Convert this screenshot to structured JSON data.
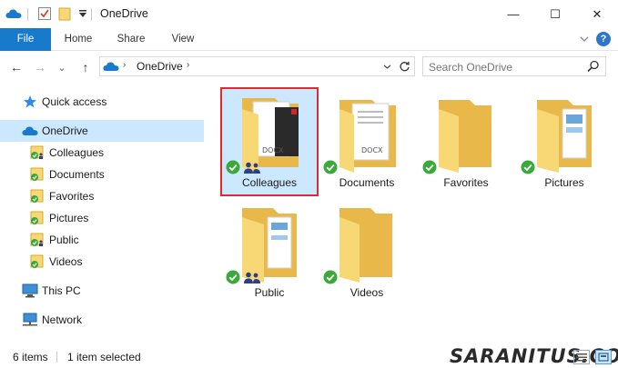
{
  "window": {
    "title": "OneDrive",
    "minimize_glyph": "—",
    "maximize_glyph": "☐",
    "close_glyph": "✕"
  },
  "ribbon": {
    "tabs": [
      {
        "label": "File"
      },
      {
        "label": "Home"
      },
      {
        "label": "Share"
      },
      {
        "label": "View"
      }
    ],
    "help_glyph": "?"
  },
  "navigation": {
    "back_glyph": "←",
    "forward_glyph": "→",
    "recent_glyph": "⌄",
    "up_glyph": "↑",
    "breadcrumb": "OneDrive",
    "search_placeholder": "Search OneDrive"
  },
  "sidebar": {
    "items": [
      {
        "label": "Quick access",
        "icon": "star-icon"
      },
      {
        "label": "OneDrive",
        "icon": "onedrive-cloud-icon"
      },
      {
        "label": "Colleagues",
        "icon": "folder-synced-icon"
      },
      {
        "label": "Documents",
        "icon": "folder-synced-icon"
      },
      {
        "label": "Favorites",
        "icon": "folder-synced-icon"
      },
      {
        "label": "Pictures",
        "icon": "folder-synced-icon"
      },
      {
        "label": "Public",
        "icon": "folder-synced-icon"
      },
      {
        "label": "Videos",
        "icon": "folder-synced-icon"
      },
      {
        "label": "This PC",
        "icon": "computer-icon"
      },
      {
        "label": "Network",
        "icon": "network-icon"
      }
    ]
  },
  "files": [
    {
      "name": "Colleagues",
      "shared": true,
      "doc_label": "DOCX"
    },
    {
      "name": "Documents",
      "shared": false,
      "doc_label": "DOCX"
    },
    {
      "name": "Favorites",
      "shared": false
    },
    {
      "name": "Pictures",
      "shared": false
    },
    {
      "name": "Public",
      "shared": true
    },
    {
      "name": "Videos",
      "shared": false
    }
  ],
  "status": {
    "item_count": "6 items",
    "selection": "1 item selected",
    "watermark": "SARANITUS.COM"
  },
  "colors": {
    "accent": "#1979ca",
    "selection_bg": "#cce8ff",
    "selection_border": "#e0282e",
    "folder_front": "#f8d775",
    "folder_back": "#e8b84a",
    "sync_green": "#3aa93a",
    "people_blue": "#2c3e86"
  }
}
